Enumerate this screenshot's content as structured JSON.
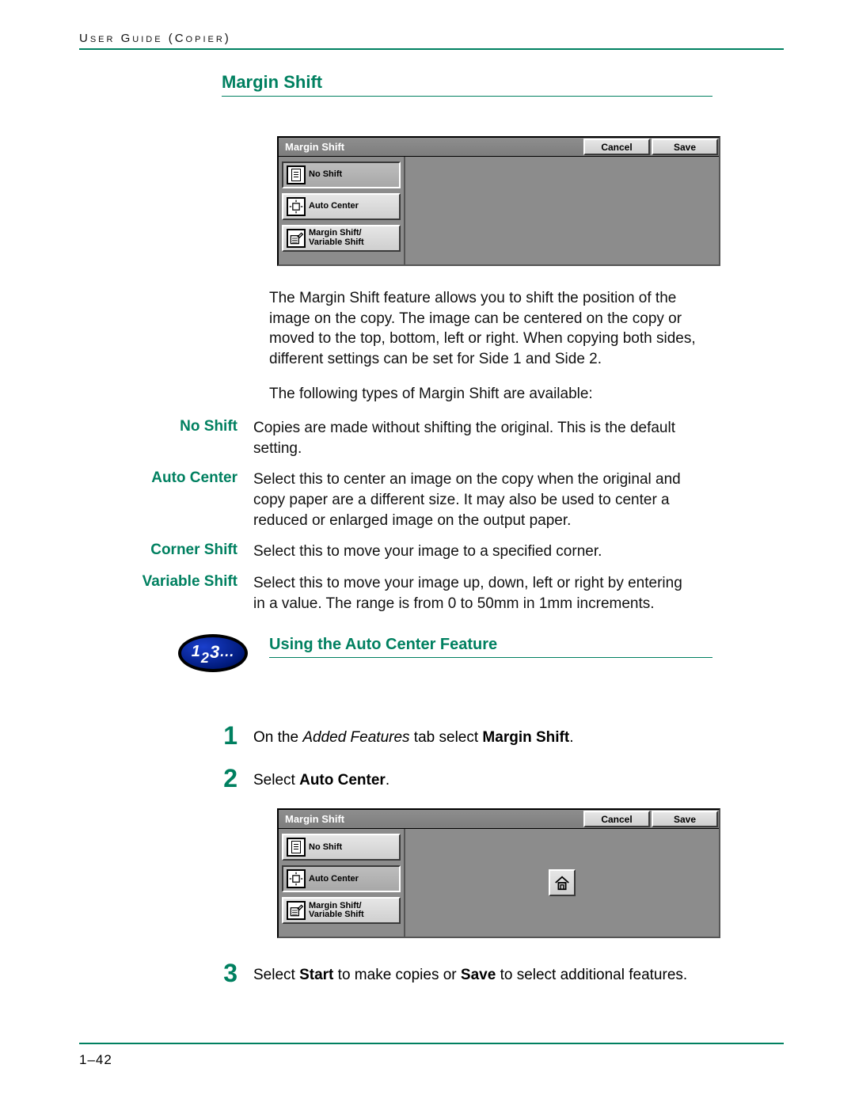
{
  "header": {
    "left": "User Guide (Copier)"
  },
  "title": "Margin Shift",
  "dialog1": {
    "title": "Margin Shift",
    "cancel": "Cancel",
    "save": "Save",
    "options": [
      "No Shift",
      "Auto Center",
      "Margin Shift/\nVariable Shift"
    ],
    "selected_index": 0,
    "show_center_icon": false
  },
  "para1": "The Margin Shift feature allows you to shift the position of the image on the copy.  The image can be centered on the copy or moved to the top, bottom, left or right.  When copying both sides, different settings can be set for Side 1 and Side 2.",
  "para2": "The following types of Margin Shift are available:",
  "defs": [
    {
      "term": "No Shift",
      "desc": "Copies are made without shifting the original.  This is the default setting."
    },
    {
      "term": "Auto Center",
      "desc": "Select this to center an image on the copy when the original and copy paper are a different size.  It may also be used to center a reduced or enlarged image on the output paper."
    },
    {
      "term": "Corner Shift",
      "desc": "Select this to move your image to a specified corner."
    },
    {
      "term": "Variable Shift",
      "desc": "Select this to move your image up, down, left or right by entering in a value.  The range is from 0 to 50mm in 1mm increments."
    }
  ],
  "subtitle": "Using the Auto Center Feature",
  "pill": "123...",
  "steps": {
    "s1_pre": "On the ",
    "s1_it": "Added Features",
    "s1_mid": " tab select ",
    "s1_b": "Margin Shift",
    "s1_post": ".",
    "s2_pre": "Select ",
    "s2_b": "Auto Center",
    "s2_post": ".",
    "s3_pre": "Select ",
    "s3_b1": "Start",
    "s3_mid": " to make copies or ",
    "s3_b2": "Save",
    "s3_post": " to select additional features."
  },
  "dialog2": {
    "title": "Margin Shift",
    "cancel": "Cancel",
    "save": "Save",
    "options": [
      "No Shift",
      "Auto Center",
      "Margin Shift/\nVariable Shift"
    ],
    "selected_index": 1,
    "show_center_icon": true
  },
  "footer": "1–42"
}
